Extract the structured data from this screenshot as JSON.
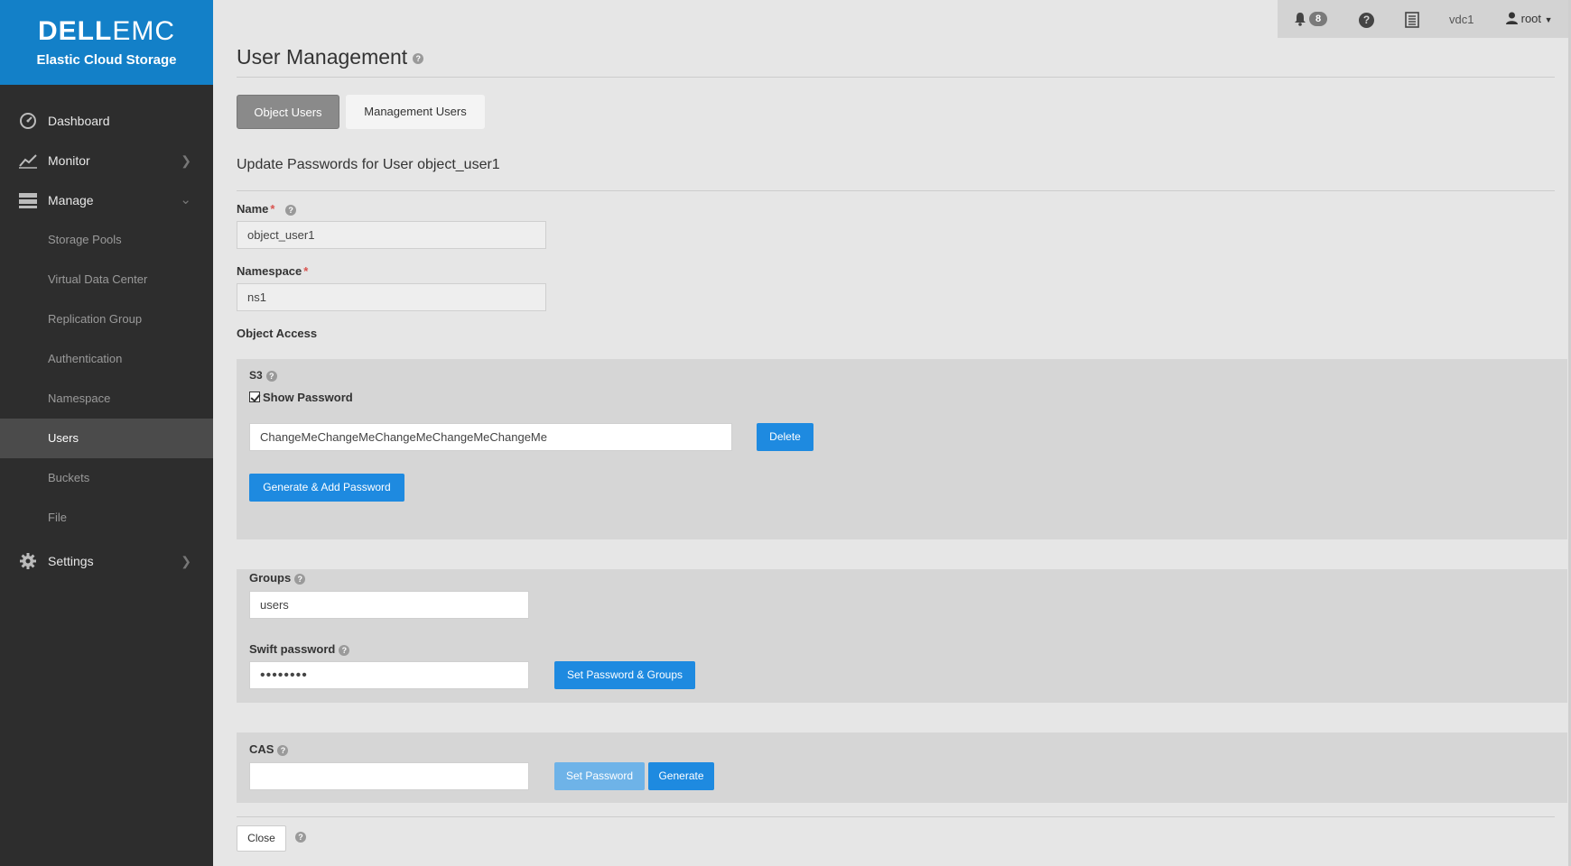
{
  "brand": {
    "logo_dell": "DELL",
    "logo_emc": "EMC",
    "product": "Elastic Cloud Storage"
  },
  "sidebar": {
    "items": [
      {
        "label": "Dashboard",
        "icon": "dashboard-icon"
      },
      {
        "label": "Monitor",
        "icon": "chart-icon",
        "chevron": ">"
      },
      {
        "label": "Manage",
        "icon": "storage-icon",
        "chevron": "v"
      }
    ],
    "manage_subitems": [
      {
        "label": "Storage Pools"
      },
      {
        "label": "Virtual Data Center"
      },
      {
        "label": "Replication Group"
      },
      {
        "label": "Authentication"
      },
      {
        "label": "Namespace"
      },
      {
        "label": "Users",
        "active": true
      },
      {
        "label": "Buckets"
      },
      {
        "label": "File"
      }
    ],
    "settings": {
      "label": "Settings",
      "icon": "gear-icon",
      "chevron": ">"
    }
  },
  "topbar": {
    "alerts_count": "8",
    "help_glyph": "?",
    "vdc": "vdc1",
    "user": "root"
  },
  "page": {
    "title": "User Management",
    "tabs": [
      {
        "label": "Object Users",
        "active": true
      },
      {
        "label": "Management Users",
        "active": false
      }
    ],
    "subtitle": "Update Passwords for User object_user1"
  },
  "form": {
    "name_label": "Name",
    "name_value": "object_user1",
    "namespace_label": "Namespace",
    "namespace_value": "ns1",
    "required_mark": "*",
    "object_access_label": "Object Access",
    "s3": {
      "label": "S3",
      "show_password_label": "Show Password",
      "show_password_checked": true,
      "password_value": "ChangeMeChangeMeChangeMeChangeMeChangeMe",
      "delete_label": "Delete",
      "generate_label": "Generate & Add Password"
    },
    "swift": {
      "groups_label": "Groups",
      "groups_value": "users",
      "password_label": "Swift password",
      "password_value": "••••••••",
      "set_label": "Set Password & Groups"
    },
    "cas": {
      "label": "CAS",
      "password_value": "",
      "set_label": "Set Password",
      "generate_label": "Generate"
    },
    "close_label": "Close"
  },
  "colors": {
    "brand_blue": "#1380c8",
    "sidebar_bg": "#2d2d2d",
    "button_blue": "#1e8ae0",
    "required_red": "#d9534f"
  }
}
